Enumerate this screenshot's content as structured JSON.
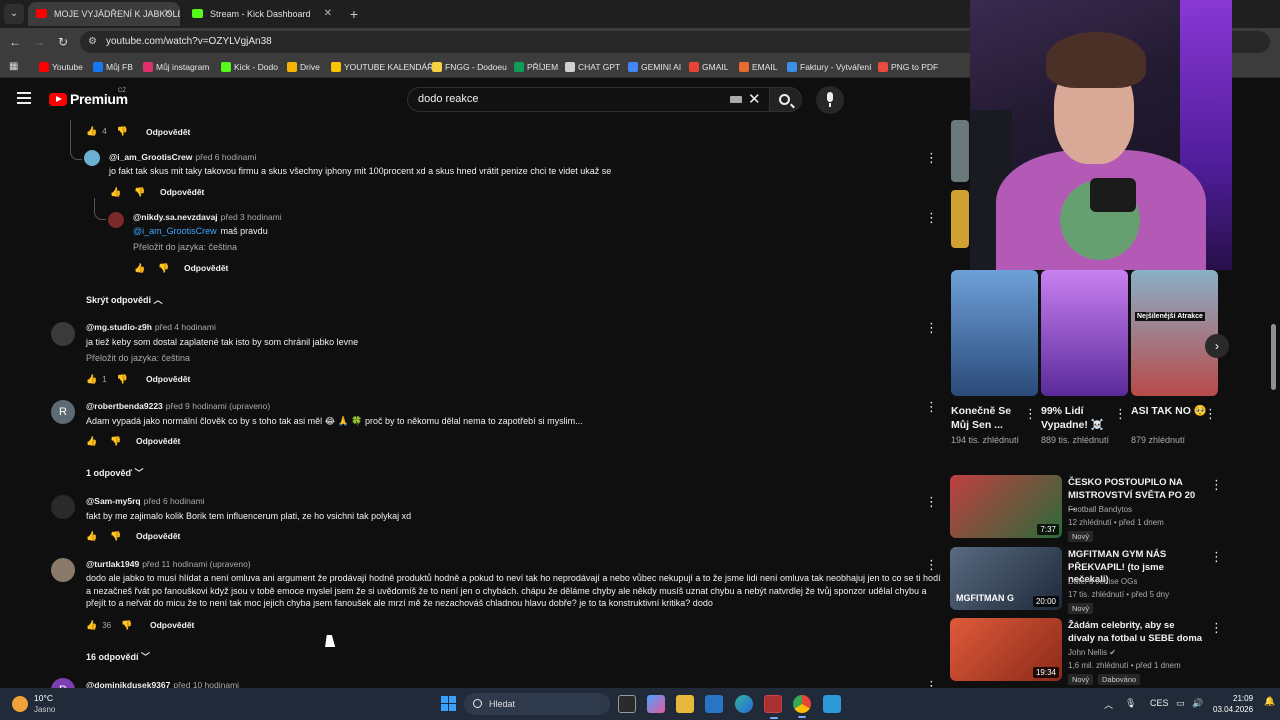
{
  "browser": {
    "tabs": [
      {
        "label": "MOJE VYJÁDŘENÍ K JABKOLEVNĚ",
        "active": true,
        "favicon_color": "#ff0000"
      },
      {
        "label": "Stream - Kick Dashboard",
        "active": false,
        "favicon_color": "#53fc18"
      }
    ],
    "url": "youtube.com/watch?v=OZYLVgjAn38",
    "bookmarks": [
      {
        "label": "Youtube",
        "color": "#ff0000"
      },
      {
        "label": "Můj FB",
        "color": "#1877f2"
      },
      {
        "label": "Můj instagram",
        "color": "#e1306c"
      },
      {
        "label": "Kick - Dodo",
        "color": "#53fc18"
      },
      {
        "label": "Drive",
        "color": "#f4b400"
      },
      {
        "label": "YOUTUBE KALENDÁŘ",
        "color": "#f9c404"
      },
      {
        "label": "FNGG - Dodoeu",
        "color": "#f5d142"
      },
      {
        "label": "PŘÍJEM",
        "color": "#0f9d58"
      },
      {
        "label": "CHAT GPT",
        "color": "#d0d0d0"
      },
      {
        "label": "GEMINI AI",
        "color": "#4285f4"
      },
      {
        "label": "GMAIL",
        "color": "#ea4335"
      },
      {
        "label": "EMAIL",
        "color": "#e86a2e"
      },
      {
        "label": "Faktury - Vytváření",
        "color": "#3a8ee6"
      },
      {
        "label": "PNG to PDF",
        "color": "#e84c3d"
      }
    ]
  },
  "youtube": {
    "brand": "Premium",
    "country": "CZ",
    "search_query": "dodo reakce"
  },
  "comments": {
    "reply_label": "Odpovědět",
    "translate_label": "Přeložit do jazyka: čeština",
    "hide_replies": "Skrýt odpovědi",
    "top_like_count": "4",
    "items": [
      {
        "author": "@i_am_GrootisCrew",
        "time": "před 6 hodinami",
        "text": "jo fakt tak skus mit taky takovou firmu a skus všechny iphony mit 100procent xd a skus hned vrátit penize chci te videt ukaž se",
        "likes": ""
      },
      {
        "author": "@nikdy.sa.nevzdavaj",
        "time": "před 3 hodinami",
        "mention": "@i_am_GrootisCrew",
        "text": "maš pravdu",
        "likes": ""
      },
      {
        "author": "@mg.studio-z9h",
        "time": "před 4 hodinami",
        "text": "ja tiež keby som dostal zaplatené tak isto by som chránil jabko levne",
        "likes": "1"
      },
      {
        "author": "@robertbenda9223",
        "time": "před 9 hodinami (upraveno)",
        "text": "Adam vypadá jako normální člověk co by s toho tak asi měl 😂 🙏 🍀 proč by to někomu dělal nema to zapotřebí si myslim...",
        "likes": "",
        "avatar_letter": "R",
        "replies": "1 odpověď"
      },
      {
        "author": "@Sam-my5rq",
        "time": "před 6 hodinami",
        "text": "fakt by me zajimalo kolik Borik tem influencerum plati, ze ho vsichni tak polykaj xd",
        "likes": ""
      },
      {
        "author": "@turtlak1949",
        "time": "před 11 hodinami (upraveno)",
        "text": "dodo ale jabko to musí hlídat a není omluva ani argument že prodávají hodně produktů hodně a pokud to neví tak ho neprodávají a nebo vůbec nekupují a to že jsme lidi není omluva tak neobhajuj  jen to co se ti hodí a nezačneš řvát po fanouškovi když jsou v tobě emoce myslel jsem že si uvědomíš že to není jen o chybách. chápu že děláme chyby ale někdy musíš uznat chybu a nebýt natvrdlej že tvůj sponzor udělal chybu a přejít to a neřvát do micu že to není tak moc jejich chyba jsem fanoušek ale mrzí mě že nezachováš chladnou hlavu dobře? je to ta konstruktivní kritika? dodo",
        "likes": "36",
        "replies": "16 odpovědí"
      },
      {
        "author": "@dominikdusek9367",
        "time": "před 10 hodinami",
        "text": "",
        "likes": "",
        "avatar_letter": "D"
      }
    ]
  },
  "sidebar": {
    "shorts": [
      {
        "title": "Konečně Se Můj Sen ...",
        "views": "194 tis. zhlédnutí",
        "color": "#3b6e3b"
      },
      {
        "title": "99% Lidí Vypadne! ☠️",
        "views": "889 tis. zhlédnutí",
        "color": "#8a46c9"
      },
      {
        "title": "ASI TAK NO 🥺",
        "views": "879 zhlédnutí",
        "color": "#6aa0c0",
        "overlay": "Nejšílenější Atrakce"
      }
    ],
    "videos": [
      {
        "title": "ČESKO POSTOUPILO NA MISTROVSTVÍ SVĚTA PO 20 ...",
        "channel": "Football Bandytos",
        "meta": "12 zhlédnutí • před 1 dnem",
        "badge": "Nový",
        "duration": "7:37",
        "color": "#b53a3a"
      },
      {
        "title": "MGFITMAN GYM NÁS PŘEKVAPIL! (to jsme nečekali)",
        "channel": "Datel u Jenise OGs",
        "meta": "17 tis. zhlédnutí • před 5 dny",
        "badge": "Nový",
        "duration": "20:00",
        "color": "#3a4a66",
        "overlay": "MGFITMAN G"
      },
      {
        "title": "Žádám celebrity, aby se dívaly na fotbal u SEBE doma",
        "channel": "John Nellis ✔",
        "meta": "1,6 mil. zhlédnutí • před 1 dnem",
        "badge": "Nový",
        "badge2": "Dabováno",
        "duration": "19:34",
        "color": "#c04a2a"
      }
    ]
  },
  "taskbar": {
    "temperature": "10°C",
    "weather": "Jasno",
    "search_placeholder": "Hledat",
    "lang": "CES",
    "time": "21:09",
    "date": "03.04.2026"
  }
}
